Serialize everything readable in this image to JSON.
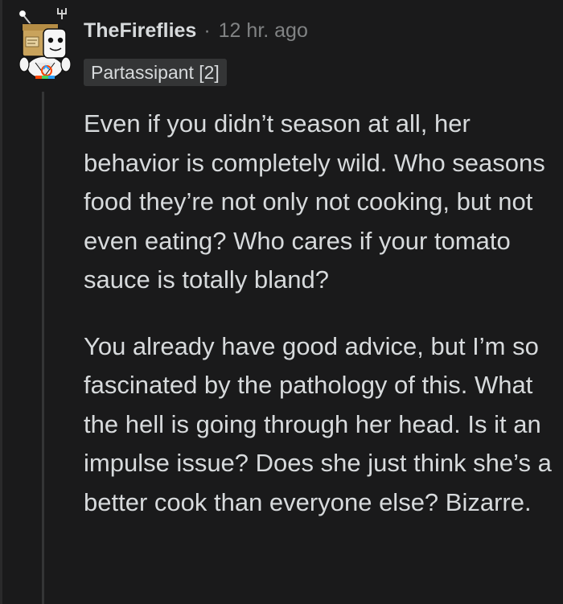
{
  "comment": {
    "username": "TheFireflies",
    "separator": "·",
    "timestamp": "12 hr. ago",
    "flair": "Partassipant [2]",
    "paragraphs": [
      "Even if you didn’t season at all, her behavior is completely wild. Who seasons food they’re not only not cooking, but not even eating? Who cares if your tomato sauce is totally bland?",
      "You already have good advice, but I’m so fascinated by the pathology of this. What the hell is going through her head. Is it an impulse issue? Does she just think she’s a better cook than everyone else? Bizarre."
    ]
  },
  "colors": {
    "background": "#1a1a1b",
    "text": "#d7dadc",
    "meta": "#818384",
    "flair_bg": "#343536",
    "thread_line": "#343536"
  },
  "icons": {
    "avatar": "snoo-box-head-avatar-icon"
  }
}
